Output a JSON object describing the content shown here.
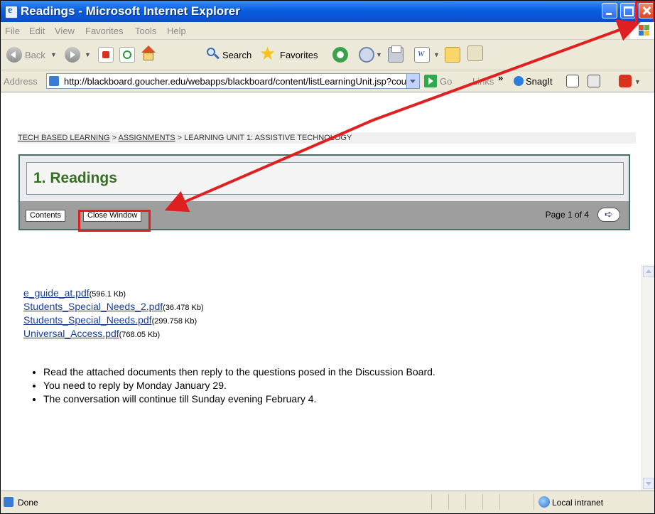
{
  "window": {
    "title": "Readings - Microsoft Internet Explorer"
  },
  "menu": [
    "File",
    "Edit",
    "View",
    "Favorites",
    "Tools",
    "Help"
  ],
  "toolbar": {
    "back_label": "Back",
    "search_label": "Search",
    "favorites_label": "Favorites"
  },
  "address": {
    "label": "Address",
    "url": "http://blackboard.goucher.edu/webapps/blackboard/content/listLearningUnit.jsp?cou",
    "go_label": "Go",
    "links_label": "Links",
    "chevron": "»",
    "snagit_label": "SnagIt"
  },
  "page": {
    "breadcrumb": {
      "part1": "TECH BASED LEARNING",
      "sep1": " > ",
      "part2": "ASSIGNMENTS",
      "sep2": " > ",
      "part3": "LEARNING UNIT 1: ASSISTIVE TECHNOLOGY"
    },
    "title": "1. Readings",
    "contents_button": "Contents",
    "close_window_button": "Close Window",
    "page_indicator": "Page 1 of 4",
    "files": [
      {
        "name": "e_guide_at.pdf",
        "size": "(596.1 Kb)"
      },
      {
        "name": "Students_Special_Needs_2.pdf",
        "size": "(36.478 Kb)"
      },
      {
        "name": "Students_Special_Needs.pdf",
        "size": "(299.758 Kb)"
      },
      {
        "name": "Universal_Access.pdf",
        "size": "(768.05 Kb)"
      }
    ],
    "notes": [
      "Read the attached documents then reply to the questions posed in the Discussion Board.",
      "You need to reply by Monday January 29.",
      "The conversation will continue till Sunday evening February 4."
    ]
  },
  "status": {
    "text": "Done",
    "zone": "Local intranet"
  },
  "colors": {
    "titlebar": "#0a5ee0",
    "annotation": "#e02020",
    "panel_border": "#44706c",
    "page_title": "#356f20"
  }
}
